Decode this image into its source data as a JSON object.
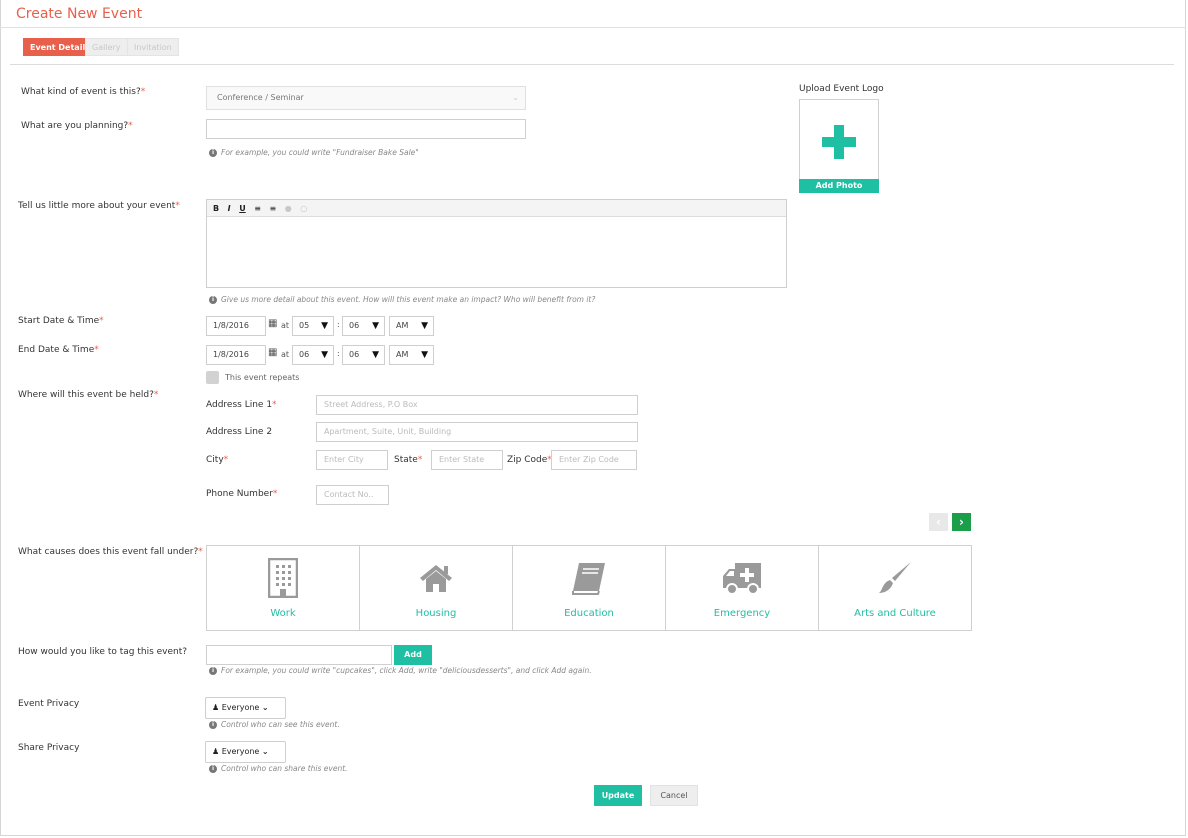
{
  "header": {
    "title": "Create New Event"
  },
  "tabs": [
    {
      "label": "Event Details",
      "active": true
    },
    {
      "label": "Gallery",
      "active": false
    },
    {
      "label": "Invitation",
      "active": false
    }
  ],
  "form": {
    "required_mark": "*",
    "kind": {
      "label": "What kind of event is this?",
      "value": "Conference / Seminar"
    },
    "planning": {
      "label": "What are you planning?",
      "value": "",
      "hint": "For example, you could write \"Fundraiser Bake Sale\""
    },
    "description": {
      "label": "Tell us little more about your event",
      "toolbar": [
        "B",
        "I",
        "U"
      ],
      "hint": "Give us more detail about this event. How will this event make an impact? Who will benefit from it?"
    },
    "start": {
      "label": "Start Date & Time",
      "date": "1/8/2016",
      "at": "at",
      "hour": "05",
      "minute": "06",
      "ampm": "AM"
    },
    "end": {
      "label": "End Date & Time",
      "date": "1/8/2016",
      "at": "at",
      "hour": "06",
      "minute": "06",
      "ampm": "AM"
    },
    "time_sep": ":",
    "repeats_label": "This event repeats",
    "location": {
      "label": "Where will this event be held?",
      "address1_label": "Address Line 1",
      "address1_placeholder": "Street Address, P.O Box",
      "address2_label": "Address Line 2",
      "address2_placeholder": "Apartment, Suite, Unit, Building",
      "city_label": "City",
      "city_placeholder": "Enter City",
      "state_label": "State",
      "state_placeholder": "Enter State",
      "zip_label": "Zip Code",
      "zip_placeholder": "Enter Zip Code",
      "phone_label": "Phone Number",
      "phone_placeholder": "Contact No.."
    },
    "causes": {
      "label": "What causes does this event fall under?",
      "items": [
        {
          "label": "Work",
          "icon": "building-icon"
        },
        {
          "label": "Housing",
          "icon": "house-icon"
        },
        {
          "label": "Education",
          "icon": "book-icon"
        },
        {
          "label": "Emergency",
          "icon": "ambulance-icon"
        },
        {
          "label": "Arts and Culture",
          "icon": "paintbrush-icon"
        }
      ]
    },
    "tags": {
      "label": "How would you like to tag this event?",
      "add_label": "Add",
      "hint": "For example, you could write \"cupcakes\", click Add, write \"deliciousdesserts\", and click Add again."
    },
    "event_privacy": {
      "label": "Event Privacy",
      "value": "Everyone",
      "hint": "Control who can see this event."
    },
    "share_privacy": {
      "label": "Share Privacy",
      "value": "Everyone",
      "hint": "Control who can share this event."
    },
    "update_label": "Update",
    "cancel_label": "Cancel"
  },
  "upload": {
    "title": "Upload Event Logo",
    "add_photo": "Add Photo"
  },
  "colors": {
    "accent": "#e8604c",
    "teal": "#1fbfa3",
    "green": "#1a9e4a"
  }
}
